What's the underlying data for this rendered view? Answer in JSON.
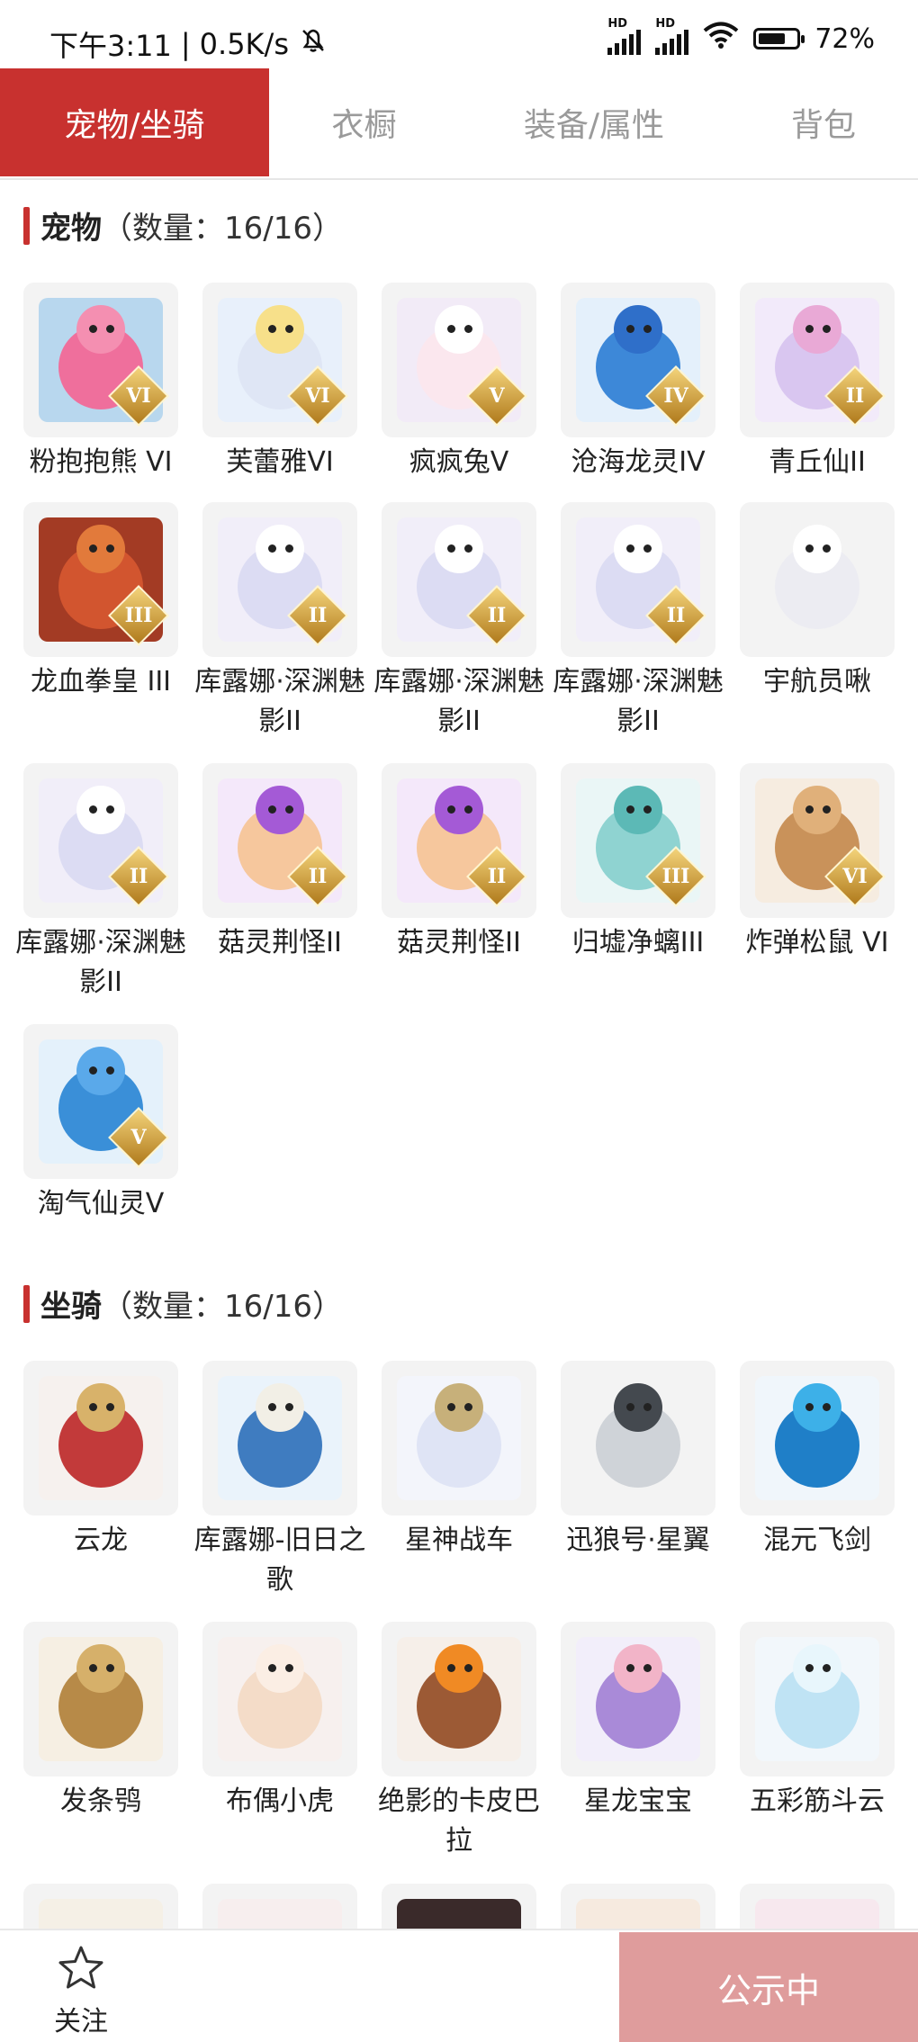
{
  "status_bar": {
    "time": "下午3:11",
    "speed": "0.5K/s",
    "separator": "|",
    "signal1_label": "HD",
    "signal2_label": "HD",
    "battery": "72%",
    "battery_level": 0.72
  },
  "tabs": [
    {
      "label": "宠物/坐骑",
      "active": true
    },
    {
      "label": "衣橱",
      "active": false
    },
    {
      "label": "装备/属性",
      "active": false
    },
    {
      "label": "背包",
      "active": false
    }
  ],
  "pets": {
    "title": "宠物",
    "count": "（数量：16/16）",
    "items": [
      {
        "name": "粉抱抱熊 VI",
        "badge": "VI",
        "bg": "#b8d7ee",
        "body": "#ef6f9c",
        "head": "#f48fb1"
      },
      {
        "name": "芙蕾雅VI",
        "badge": "VI",
        "bg": "#e8f0fb",
        "body": "#dfe6f5",
        "head": "#f7e08a"
      },
      {
        "name": "疯疯兔V",
        "badge": "V",
        "bg": "#f2ebf7",
        "body": "#fbe7ee",
        "head": "#ffffff"
      },
      {
        "name": "沧海龙灵IV",
        "badge": "IV",
        "bg": "#e4f0fb",
        "body": "#3d88d8",
        "head": "#2f6fc9"
      },
      {
        "name": "青丘仙II",
        "badge": "II",
        "bg": "#f2eafa",
        "body": "#d9c6f0",
        "head": "#e9a9d6"
      },
      {
        "name": "龙血拳皇 III",
        "badge": "III",
        "bg": "#a33b24",
        "body": "#d2552f",
        "head": "#e27a3b"
      },
      {
        "name": "库露娜·深渊魅影II",
        "badge": "II",
        "bg": "#f1eef9",
        "body": "#dcdcf3",
        "head": "#ffffff"
      },
      {
        "name": "库露娜·深渊魅影II",
        "badge": "II",
        "bg": "#f1eef9",
        "body": "#dcdcf3",
        "head": "#ffffff"
      },
      {
        "name": "库露娜·深渊魅影II",
        "badge": "II",
        "bg": "#f1eef9",
        "body": "#dcdcf3",
        "head": "#ffffff"
      },
      {
        "name": "宇航员啾",
        "badge": "",
        "bg": "#f3f3f3",
        "body": "#ececf2",
        "head": "#ffffff"
      },
      {
        "name": "库露娜·深渊魅影II",
        "badge": "II",
        "bg": "#f1eef9",
        "body": "#dcdcf3",
        "head": "#ffffff"
      },
      {
        "name": "菇灵荆怪II",
        "badge": "II",
        "bg": "#f4e8fa",
        "body": "#f6c79d",
        "head": "#a45ad6"
      },
      {
        "name": "菇灵荆怪II",
        "badge": "II",
        "bg": "#f4e8fa",
        "body": "#f6c79d",
        "head": "#a45ad6"
      },
      {
        "name": "归墟净螭III",
        "badge": "III",
        "bg": "#eaf6f6",
        "body": "#8fd3d1",
        "head": "#5cb9b6"
      },
      {
        "name": "炸弹松鼠 VI",
        "badge": "VI",
        "bg": "#f6ece0",
        "body": "#c9925a",
        "head": "#e0b07a"
      },
      {
        "name": "淘气仙灵V",
        "badge": "V",
        "bg": "#e4f1fb",
        "body": "#3a8fd8",
        "head": "#5aa9ea"
      }
    ]
  },
  "mounts": {
    "title": "坐骑",
    "count": "（数量：16/16）",
    "items": [
      {
        "name": "云龙",
        "badge": "",
        "bg": "#f6f1ee",
        "body": "#c23a3a",
        "head": "#d8b26a"
      },
      {
        "name": "库露娜-旧日之歌",
        "badge": "",
        "bg": "#eaf3fb",
        "body": "#3f7cc0",
        "head": "#f2efe6"
      },
      {
        "name": "星神战车",
        "badge": "",
        "bg": "#f3f5fb",
        "body": "#dfe4f5",
        "head": "#c7b07a"
      },
      {
        "name": "迅狼号·星翼",
        "badge": "",
        "bg": "#f3f3f3",
        "body": "#cfd3d8",
        "head": "#44494f"
      },
      {
        "name": "混元飞剑",
        "badge": "",
        "bg": "#f0f6fb",
        "body": "#1f7fc8",
        "head": "#3db0e8"
      },
      {
        "name": "发条鸮",
        "badge": "",
        "bg": "#f6efe3",
        "body": "#b78a48",
        "head": "#d6b06a"
      },
      {
        "name": "布偶小虎",
        "badge": "",
        "bg": "#f7f0ee",
        "body": "#f4dcc8",
        "head": "#fbeee4"
      },
      {
        "name": "绝影的卡皮巴拉",
        "badge": "",
        "bg": "#f6efe9",
        "body": "#9c5a35",
        "head": "#f08a24"
      },
      {
        "name": "星龙宝宝",
        "badge": "",
        "bg": "#f2eefa",
        "body": "#a98ad8",
        "head": "#f2b4c8"
      },
      {
        "name": "五彩筋斗云",
        "badge": "",
        "bg": "#f2f7fb",
        "body": "#bfe3f4",
        "head": "#e8f6fc"
      }
    ]
  },
  "bottom": {
    "follow": "关注",
    "public": "公示中"
  }
}
